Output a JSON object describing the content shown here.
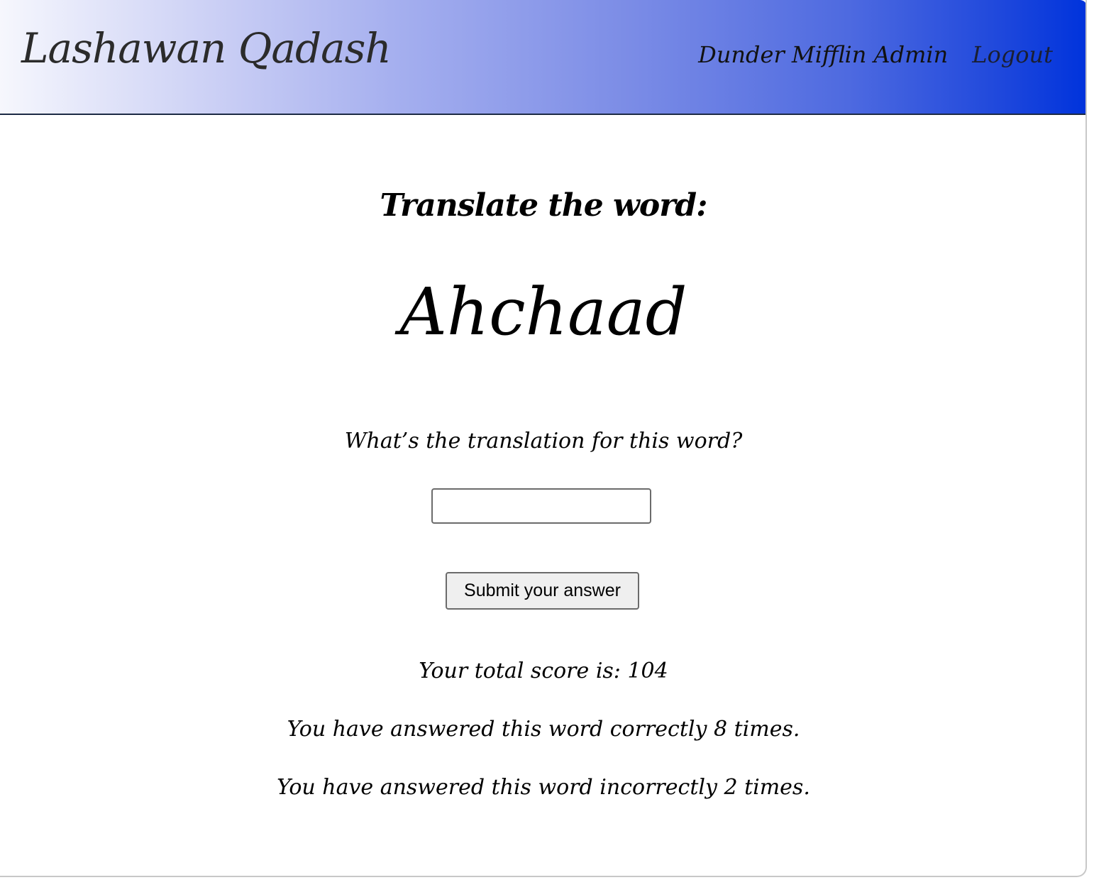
{
  "header": {
    "brand": "Lashawan Qadash",
    "user_name": "Dunder Mifflin Admin",
    "logout_label": "Logout"
  },
  "quiz": {
    "heading": "Translate the word:",
    "word": "Ahchaad",
    "question": "What’s the translation for this word?",
    "answer_value": "",
    "submit_label": "Submit your answer"
  },
  "stats": {
    "total_score": "Your total score is: 104",
    "correct": "You have answered this word correctly 8 times.",
    "incorrect": "You have answered this word incorrectly 2 times."
  },
  "colors": {
    "header_gradient_start": "#f6f7fd",
    "header_gradient_end": "#0033dc",
    "header_border": "#1c2a44",
    "button_bg": "#efefef"
  }
}
